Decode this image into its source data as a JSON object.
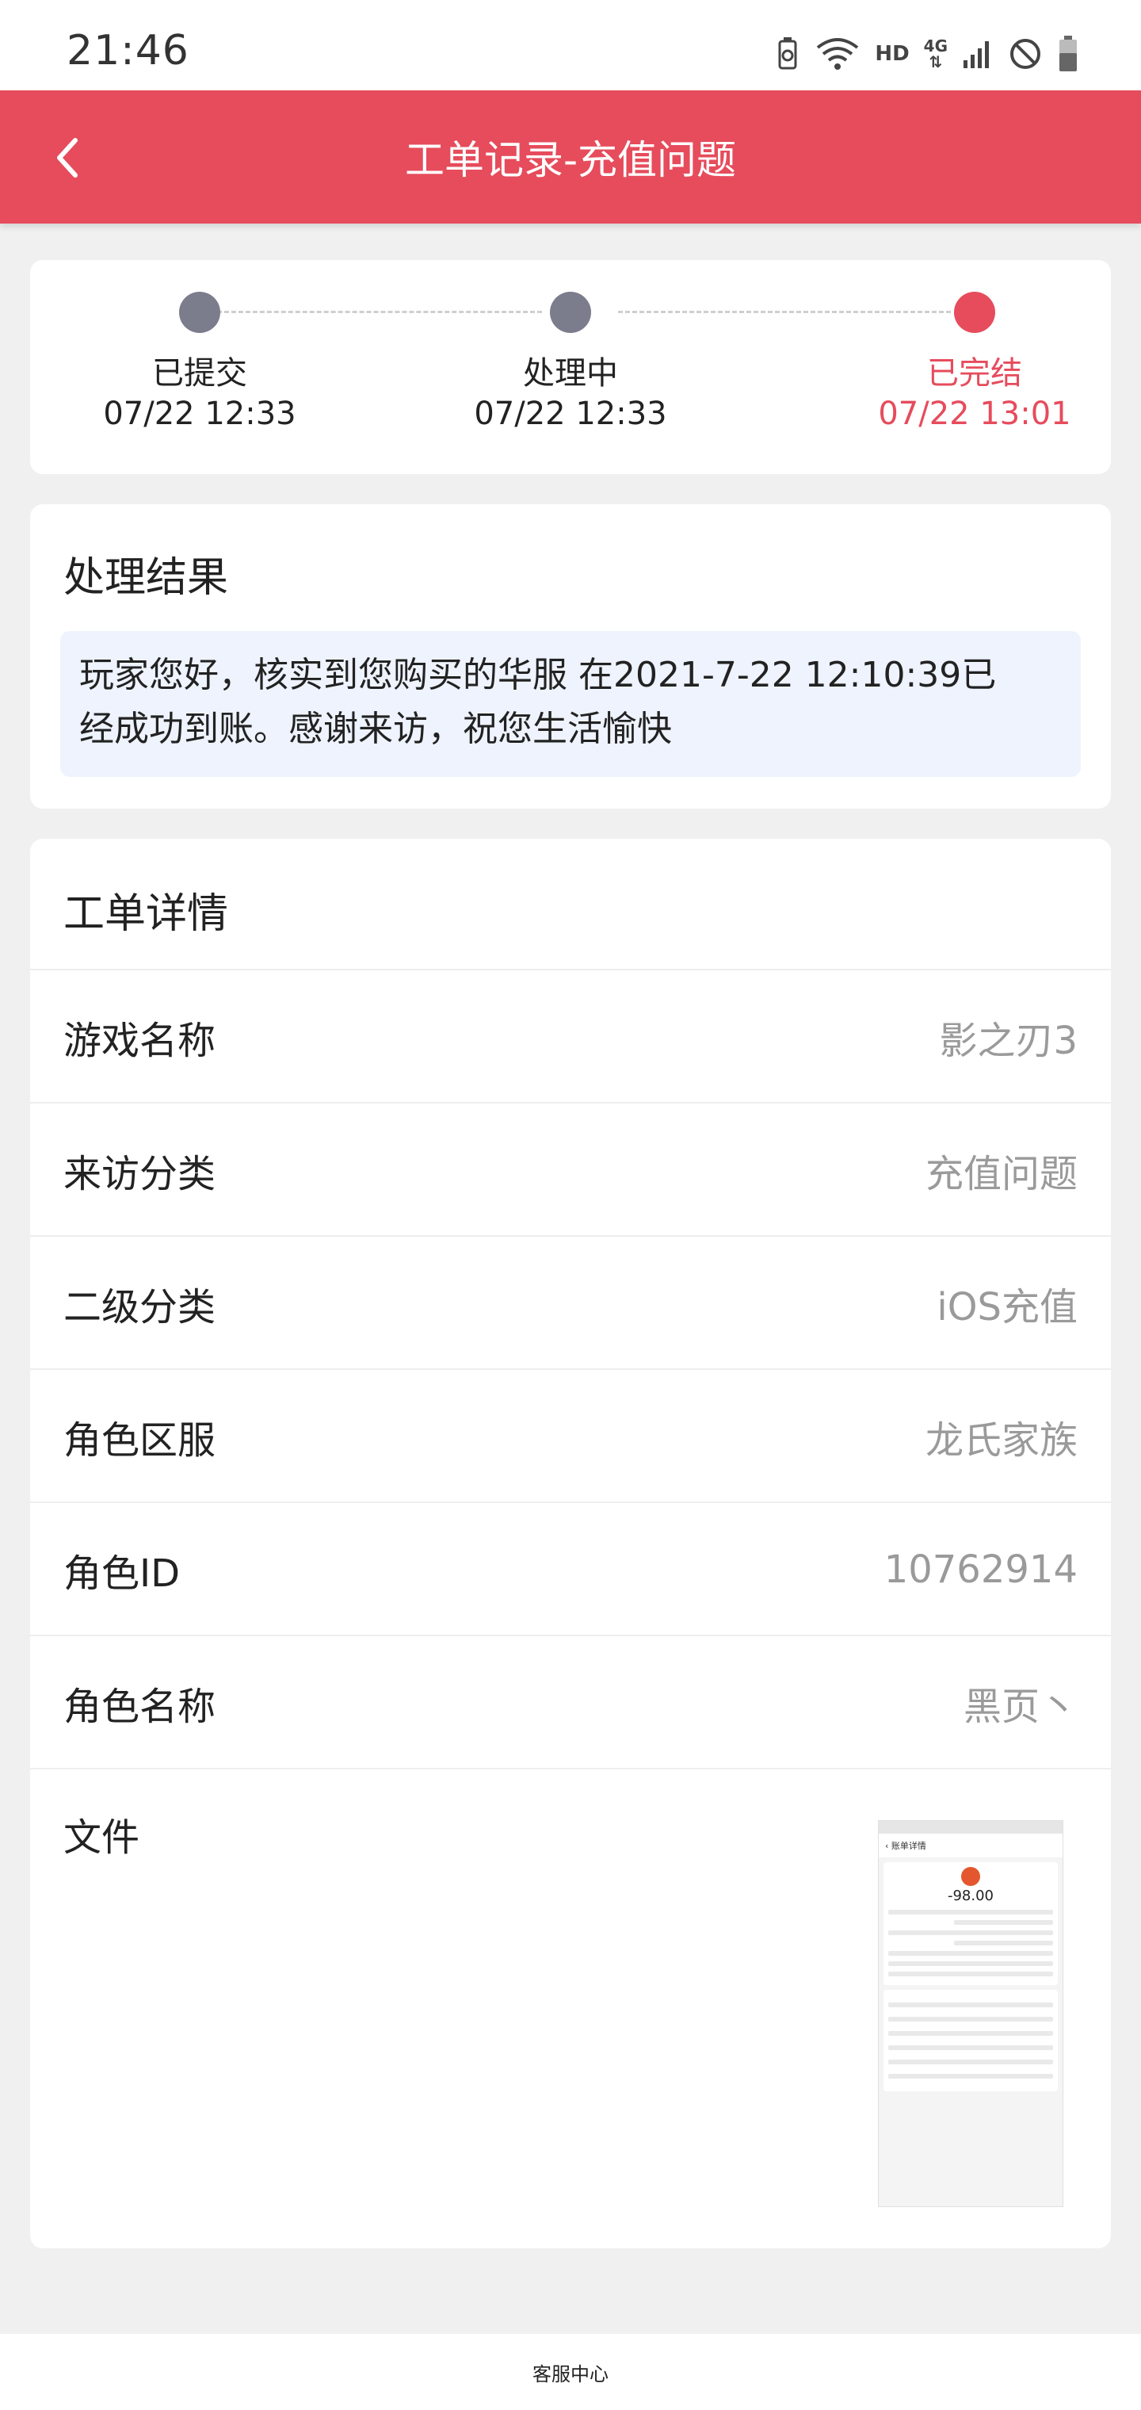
{
  "status_bar": {
    "time": "21:46",
    "network_label": "HD",
    "signal_label": "4G",
    "icons": [
      "battery-saver-icon",
      "wifi-icon",
      "signal-icon",
      "do-not-disturb-icon",
      "battery-icon"
    ]
  },
  "header": {
    "title": "工单记录-充值问题",
    "back_icon": "chevron-left-icon",
    "background_color": "#e64c5c"
  },
  "progress": {
    "steps": [
      {
        "label": "已提交",
        "time": "07/22 12:33",
        "active": false
      },
      {
        "label": "处理中",
        "time": "07/22 12:33",
        "active": false
      },
      {
        "label": "已完结",
        "time": "07/22 13:01",
        "active": true
      }
    ],
    "active_color": "#e64c5c",
    "inactive_color": "#7b7c8c"
  },
  "result": {
    "title": "处理结果",
    "line1": "玩家您好，核实到您购买的华服 在2021-7-22 12:10:39已",
    "line2": "经成功到账。感谢来访，祝您生活愉快"
  },
  "details": {
    "title": "工单详情",
    "rows": [
      {
        "label": "游戏名称",
        "value": "影之刃3"
      },
      {
        "label": "来访分类",
        "value": "充值问题"
      },
      {
        "label": "二级分类",
        "value": "iOS充值"
      },
      {
        "label": "角色区服",
        "value": "龙氏家族"
      },
      {
        "label": "角色ID",
        "value": "10762914"
      },
      {
        "label": "角色名称",
        "value": "黑页丶"
      }
    ],
    "file_label": "文件",
    "file_thumbnail": {
      "amount": "-98.00",
      "header": "账单详情"
    }
  },
  "footer": {
    "label": "客服中心"
  }
}
